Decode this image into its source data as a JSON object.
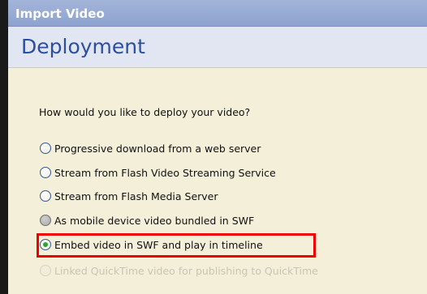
{
  "window": {
    "title": "Import Video",
    "section_heading": "Deployment"
  },
  "deployment": {
    "question": "How would you like to deploy your video?",
    "options": [
      {
        "label": "Progressive download from a web server",
        "selected": false,
        "enabled": true
      },
      {
        "label": "Stream from Flash Video Streaming Service",
        "selected": false,
        "enabled": true
      },
      {
        "label": "Stream from Flash Media Server",
        "selected": false,
        "enabled": true
      },
      {
        "label": "As mobile device video bundled in SWF",
        "selected": false,
        "enabled": true
      },
      {
        "label": "Embed video in SWF and play in timeline",
        "selected": true,
        "enabled": true
      },
      {
        "label": "Linked QuickTime video for publishing to QuickTime",
        "selected": false,
        "enabled": false
      }
    ]
  },
  "colors": {
    "highlight": "#ef0000",
    "selected_dot": "#2da634",
    "heading": "#2c4ea3"
  }
}
